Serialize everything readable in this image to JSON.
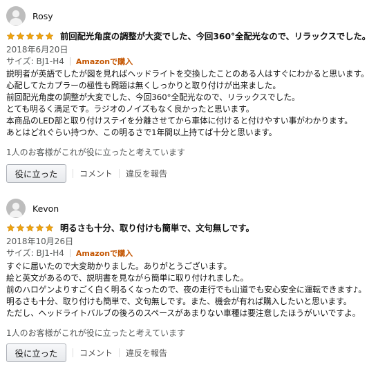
{
  "reviews": [
    {
      "reviewer": "Rosy",
      "rating": 5,
      "title": "前回配光角度の調整が大変でした、今回360°全配光なので、リラックスでした。",
      "date": "2018年6月20日",
      "size": "サイズ: BJ1-H4",
      "verified": "Amazonで購入",
      "body": [
        "説明者が英語でしたが図を見ればヘッドライトを交換したことのある人はすぐにわかると思います。",
        "心配してたカプラーの極性も問題は無くしっかりと取り付けが出来ました。",
        "前回配光角度の調整が大変でした、今回360°全配光なので、リラックスでした。",
        "とても明るく満足です。ラジオのノイズもなく良かったと思います。",
        "本商品のLED部と取り付けステイを分離させてから車体に付けると付けやすい事がわかります。",
        "あとはどれぐらい持つか、この明るさで1年間以上持てば十分と思います。"
      ],
      "helpful_text": "1人のお客様がこれが役に立ったと考えています",
      "helpful_button": "役に立った",
      "comment_link": "コメント",
      "report_link": "違反を報告"
    },
    {
      "reviewer": "Kevon",
      "rating": 5,
      "title": "明るさも十分、取り付けも簡単で、文句無しです。",
      "date": "2018年10月26日",
      "size": "サイズ: BJ1-H4",
      "verified": "Amazonで購入",
      "body": [
        "すぐに届いたので大変助かりました。ありがとうございます。",
        "絵と英文があるので、説明書を見ながら簡単に取り付けれました。",
        "前のハロゲンよりすごく白く明るくなったので、夜の走行でも山道でも安心安全に運転できます♪。",
        "明るさも十分、取り付けも簡単で、文句無しです。また、機会が有れば購入したいと思います。",
        "ただし、ヘッドライトバルブの後ろのスペースがあまりない車種は要注意したほうがいいですよ。"
      ],
      "helpful_text": "1人のお客様がこれが役に立ったと考えています",
      "helpful_button": "役に立った",
      "comment_link": "コメント",
      "report_link": "違反を報告"
    }
  ],
  "colors": {
    "star": "#f0a30a",
    "verified": "#c45500",
    "muted": "#565959"
  },
  "icons": {
    "avatar": "default-avatar-icon",
    "star": "star-icon"
  }
}
